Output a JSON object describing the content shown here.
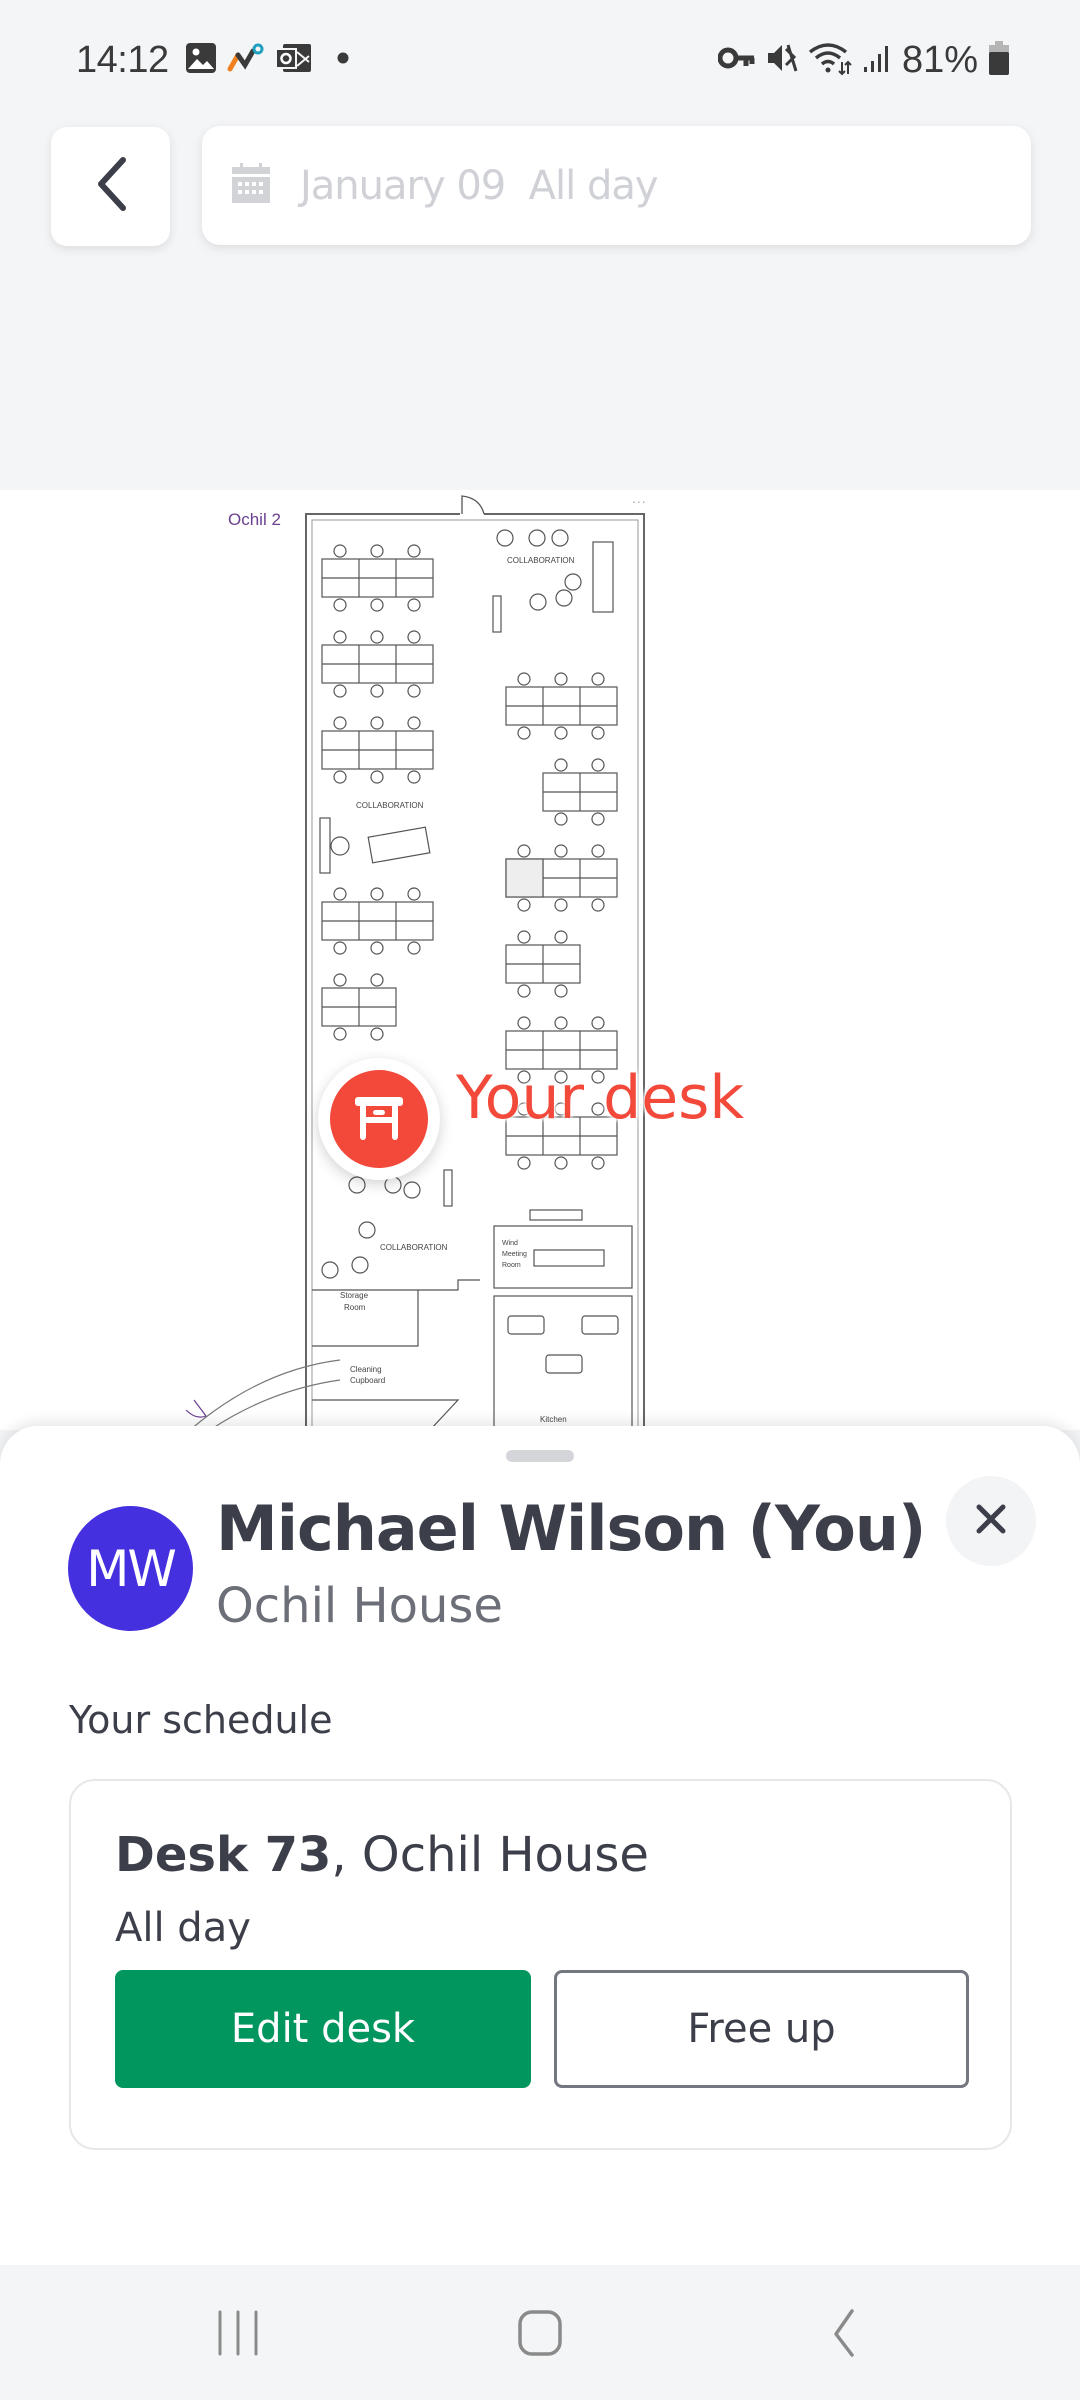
{
  "status_bar": {
    "time": "14:12",
    "battery_percent": "81%",
    "left_icons": [
      "gallery-icon",
      "app-notification-icon",
      "outlook-icon",
      "dot-icon"
    ],
    "right_icons": [
      "vpn-key-icon",
      "mute-icon",
      "wifi-icon",
      "signal-icon",
      "battery-icon"
    ]
  },
  "header": {
    "back_icon": "chevron-left-icon",
    "date_icon": "calendar-icon",
    "date_text": "January 09  All day"
  },
  "map": {
    "floor_label": "Ochil 2",
    "more_label": "...",
    "room_labels": {
      "collab_top": "COLLABORATION",
      "collab_mid": "COLLABORATION",
      "collab_bottom": "COLLABORATION",
      "meeting_room_1": "Wind",
      "meeting_room_2": "Meeting",
      "meeting_room_3": "Room",
      "storage_1": "Storage",
      "storage_2": "Room",
      "cleaning_1": "Cleaning",
      "cleaning_2": "Cupboard",
      "kitchen": "Kitchen"
    },
    "your_desk_label": "Your desk",
    "pin_color": "#f2493b"
  },
  "sheet": {
    "avatar_initials": "MW",
    "avatar_color": "#4530e0",
    "user_name": "Michael Wilson (You)",
    "user_location": "Ochil House",
    "schedule_title": "Your schedule",
    "booking": {
      "desk": "Desk 73",
      "separator": ", ",
      "building": "Ochil House",
      "time": "All day"
    },
    "edit_button": "Edit desk",
    "free_button": "Free up",
    "primary_color": "#02965f"
  },
  "nav_bar": {
    "recents": "recents-icon",
    "home": "home-icon",
    "back": "back-icon"
  }
}
